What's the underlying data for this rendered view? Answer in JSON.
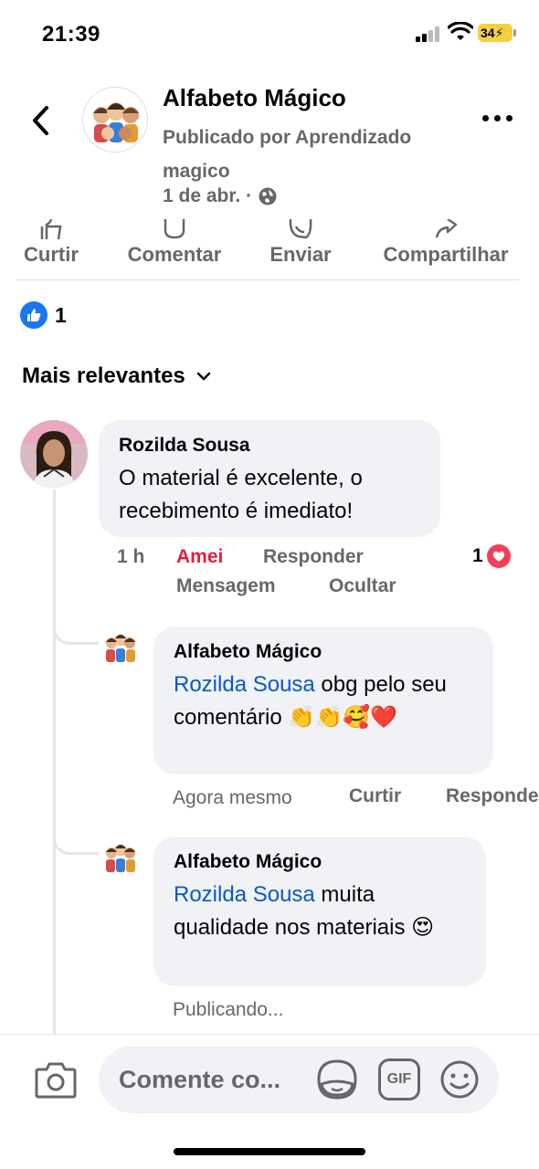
{
  "status_bar": {
    "time": "21:39",
    "battery": "34"
  },
  "post": {
    "page_name": "Alfabeto Mágico",
    "published_by": "Publicado por Aprendizado magico",
    "date": "1 de abr. ·",
    "privacy_icon": "globe-icon"
  },
  "actions": {
    "like": "Curtir",
    "comment": "Comentar",
    "send": "Enviar",
    "share": "Compartilhar"
  },
  "reactions": {
    "count": "1",
    "icon": "like-icon"
  },
  "sort": {
    "label": "Mais relevantes"
  },
  "comments": [
    {
      "author": "Rozilda Sousa",
      "text": "O material é excelente, o recebimento é imediato!",
      "time": "1 h",
      "reaction_label": "Amei",
      "reply_label": "Responder",
      "message_label": "Mensagem",
      "hide_label": "Ocultar",
      "reaction_count": "1",
      "replies": [
        {
          "author": "Alfabeto Mágico",
          "mention": "Rozilda Sousa",
          "text": " obg pelo seu comentário 👏👏🥰❤️",
          "time": "Agora mesmo",
          "like_label": "Curtir",
          "reply_label": "Responder"
        },
        {
          "author": "Alfabeto Mágico",
          "mention": "Rozilda Sousa",
          "text": " muita qualidade nos materiais 😍",
          "status": "Publicando..."
        }
      ]
    }
  ],
  "composer": {
    "placeholder": "Comente co...",
    "gif_label": "GIF"
  },
  "colors": {
    "accent": "#1877f2",
    "mention": "#0a58ca",
    "love": "#e41e3f",
    "muted": "#65676b",
    "bubble": "#f0f2f5"
  }
}
